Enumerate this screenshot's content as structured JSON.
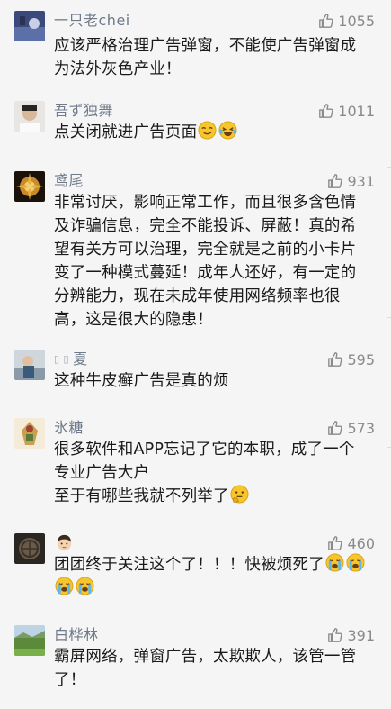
{
  "comments": [
    {
      "username": "一只老chei",
      "likes": "1055",
      "lines": [
        "应该严格治理广告弹窗，不能使广告弹窗成",
        "为法外灰色产业！"
      ]
    },
    {
      "username": "吾ず独舞",
      "likes": "1011",
      "lines": [
        "点关闭就进广告页面"
      ],
      "emojis": [
        "smirk-emoji",
        "laugh-crying-emoji"
      ]
    },
    {
      "username": "鸢尾",
      "likes": "931",
      "lines": [
        "非常讨厌，影响正常工作，而且很多含色情",
        "及诈骗信息，完全不能投诉、屏蔽！真的希",
        "望有关方可以治理，完全就是之前的小卡片",
        "变了一种模式蔓延！成年人还好，有一定的",
        "分辨能力，现在未成年使用网络频率也很",
        "高，这是很大的隐患！"
      ]
    },
    {
      "username": "夏",
      "likes": "595",
      "lines": [
        "这种牛皮癣广告是真的烦"
      ]
    },
    {
      "username": "氷糖",
      "likes": "573",
      "lines": [
        "很多软件和APP忘记了它的本职，成了一个",
        "专业广告大户",
        "至于有哪些我就不列举了"
      ],
      "emojis": [
        "thinking-emoji"
      ]
    },
    {
      "username": "",
      "likes": "460",
      "lines": [
        "团团终于关注这个了！！！快被烦死了"
      ],
      "emojis": [
        "crying-emoji",
        "crying-emoji",
        "crying-emoji",
        "crying-emoji"
      ]
    },
    {
      "username": "白桦林",
      "likes": "391",
      "lines": [
        "霸屏网络，弹窗广告，太欺欺人，该管一管",
        "了！"
      ]
    }
  ],
  "colors": {
    "background": "#f5f5f5",
    "username": "#6e7a8a",
    "text": "#1a1a1a",
    "like": "#8a8a8a"
  },
  "icons": {
    "like": "thumbs-up-icon"
  }
}
